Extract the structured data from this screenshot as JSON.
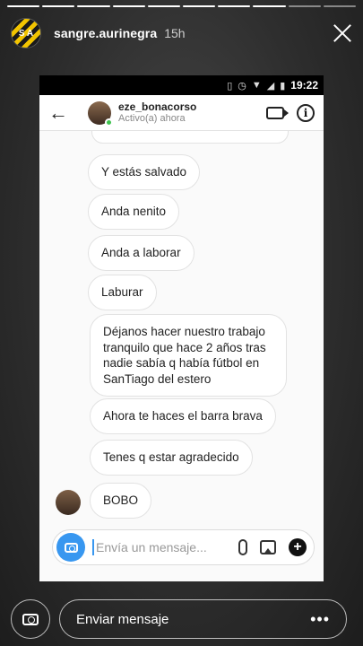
{
  "story": {
    "username": "sangre.aurinegra",
    "time_ago": "15h",
    "avatar_text": "S A"
  },
  "phone": {
    "status_time": "19:22",
    "dm": {
      "username": "eze_bonacorso",
      "status": "Activo(a) ahora"
    },
    "messages": [
      "Y estás salvado",
      "Anda nenito",
      "Anda a laborar",
      "Laburar",
      "Déjanos hacer nuestro trabajo tranquilo que hace 2 años tras nadie sabía q había fútbol en SanTiago del estero",
      "Ahora te haces el barra brava",
      "Tenes q estar agradecido",
      "BOBO"
    ],
    "composer_placeholder": "Envía un mensaje..."
  },
  "reply": {
    "placeholder": "Enviar mensaje",
    "more": "•••"
  },
  "colors": {
    "accent_blue": "#3897f0",
    "online_green": "#3fc34f",
    "brand_yellow": "#f2c400"
  }
}
